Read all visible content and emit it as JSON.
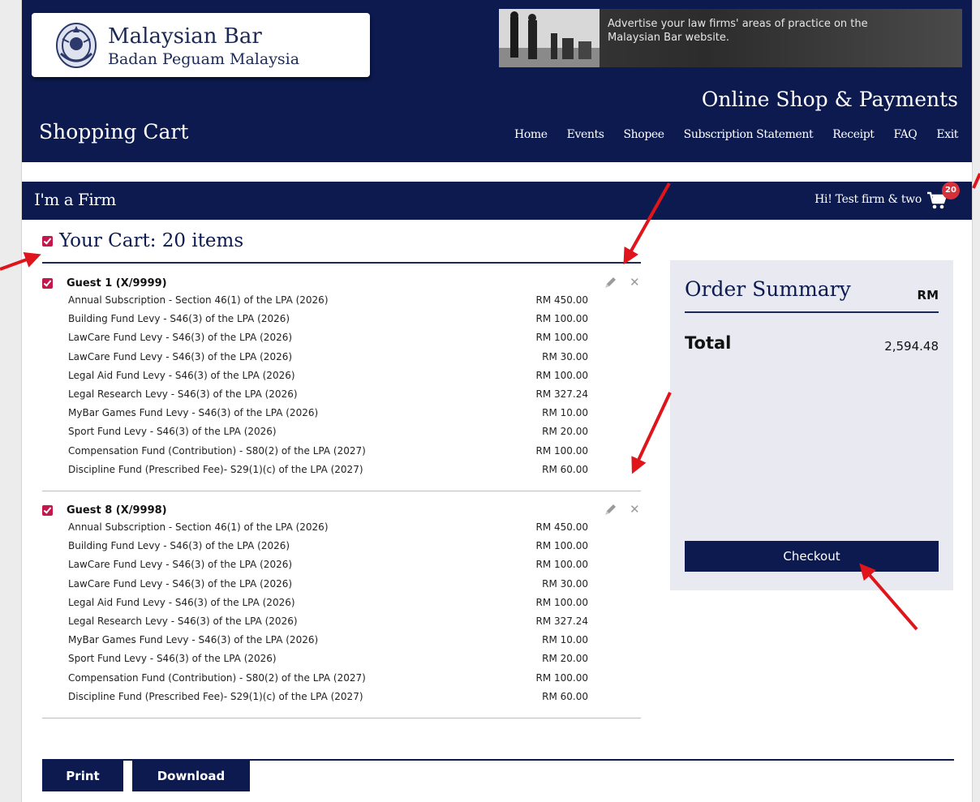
{
  "brand": {
    "name": "Malaysian Bar",
    "subtitle": "Badan Peguam Malaysia"
  },
  "ad": {
    "text": "Advertise your law firms' areas of practice on the Malaysian Bar website."
  },
  "header": {
    "shop_title": "Online Shop & Payments",
    "page_title": "Shopping Cart",
    "nav": [
      "Home",
      "Events",
      "Shopee",
      "Subscription Statement",
      "Receipt",
      "FAQ",
      "Exit"
    ]
  },
  "firm_bar": {
    "title": "I'm a Firm",
    "greeting": "Hi! Test firm & two",
    "cart_count": "20"
  },
  "cart": {
    "heading": "Your Cart: 20 items",
    "groups": [
      {
        "name": "Guest 1 (X/9999)",
        "items": [
          {
            "desc": "Annual Subscription - Section 46(1) of the LPA (2026)",
            "amount": "RM 450.00"
          },
          {
            "desc": "Building Fund Levy - S46(3) of the LPA (2026)",
            "amount": "RM 100.00"
          },
          {
            "desc": "LawCare Fund Levy - S46(3) of the LPA (2026)",
            "amount": "RM 100.00"
          },
          {
            "desc": "LawCare Fund Levy - S46(3) of the LPA (2026)",
            "amount": "RM 30.00"
          },
          {
            "desc": "Legal Aid Fund Levy - S46(3) of the LPA (2026)",
            "amount": "RM 100.00"
          },
          {
            "desc": "Legal Research Levy - S46(3) of the LPA (2026)",
            "amount": "RM 327.24"
          },
          {
            "desc": "MyBar Games Fund Levy - S46(3) of the LPA (2026)",
            "amount": "RM 10.00"
          },
          {
            "desc": "Sport Fund Levy - S46(3) of the LPA (2026)",
            "amount": "RM 20.00"
          },
          {
            "desc": "Compensation Fund (Contribution) - S80(2) of the LPA (2027)",
            "amount": "RM 100.00"
          },
          {
            "desc": "Discipline Fund (Prescribed Fee)- S29(1)(c) of the LPA (2027)",
            "amount": "RM 60.00"
          }
        ]
      },
      {
        "name": "Guest 8 (X/9998)",
        "items": [
          {
            "desc": "Annual Subscription - Section 46(1) of the LPA (2026)",
            "amount": "RM 450.00"
          },
          {
            "desc": "Building Fund Levy - S46(3) of the LPA (2026)",
            "amount": "RM 100.00"
          },
          {
            "desc": "LawCare Fund Levy - S46(3) of the LPA (2026)",
            "amount": "RM 100.00"
          },
          {
            "desc": "LawCare Fund Levy - S46(3) of the LPA (2026)",
            "amount": "RM 30.00"
          },
          {
            "desc": "Legal Aid Fund Levy - S46(3) of the LPA (2026)",
            "amount": "RM 100.00"
          },
          {
            "desc": "Legal Research Levy - S46(3) of the LPA (2026)",
            "amount": "RM 327.24"
          },
          {
            "desc": "MyBar Games Fund Levy - S46(3) of the LPA (2026)",
            "amount": "RM 10.00"
          },
          {
            "desc": "Sport Fund Levy - S46(3) of the LPA (2026)",
            "amount": "RM 20.00"
          },
          {
            "desc": "Compensation Fund (Contribution) - S80(2) of the LPA (2027)",
            "amount": "RM 100.00"
          },
          {
            "desc": "Discipline Fund (Prescribed Fee)- S29(1)(c) of the LPA (2027)",
            "amount": "RM 60.00"
          }
        ]
      }
    ]
  },
  "summary": {
    "title": "Order Summary",
    "currency": "RM",
    "total_label": "Total",
    "total_value": "2,594.48",
    "checkout_label": "Checkout"
  },
  "footer": {
    "print_label": "Print",
    "download_label": "Download"
  },
  "colors": {
    "navy": "#0c1a4f",
    "checkbox": "#c4174b",
    "badge": "#d8303a",
    "annotation_arrow": "#e0141b"
  },
  "icons": [
    "bar-emblem-icon",
    "cart-icon",
    "checkbox-checked-icon",
    "edit-pencil-icon",
    "close-x-icon",
    "annotation-arrow"
  ]
}
